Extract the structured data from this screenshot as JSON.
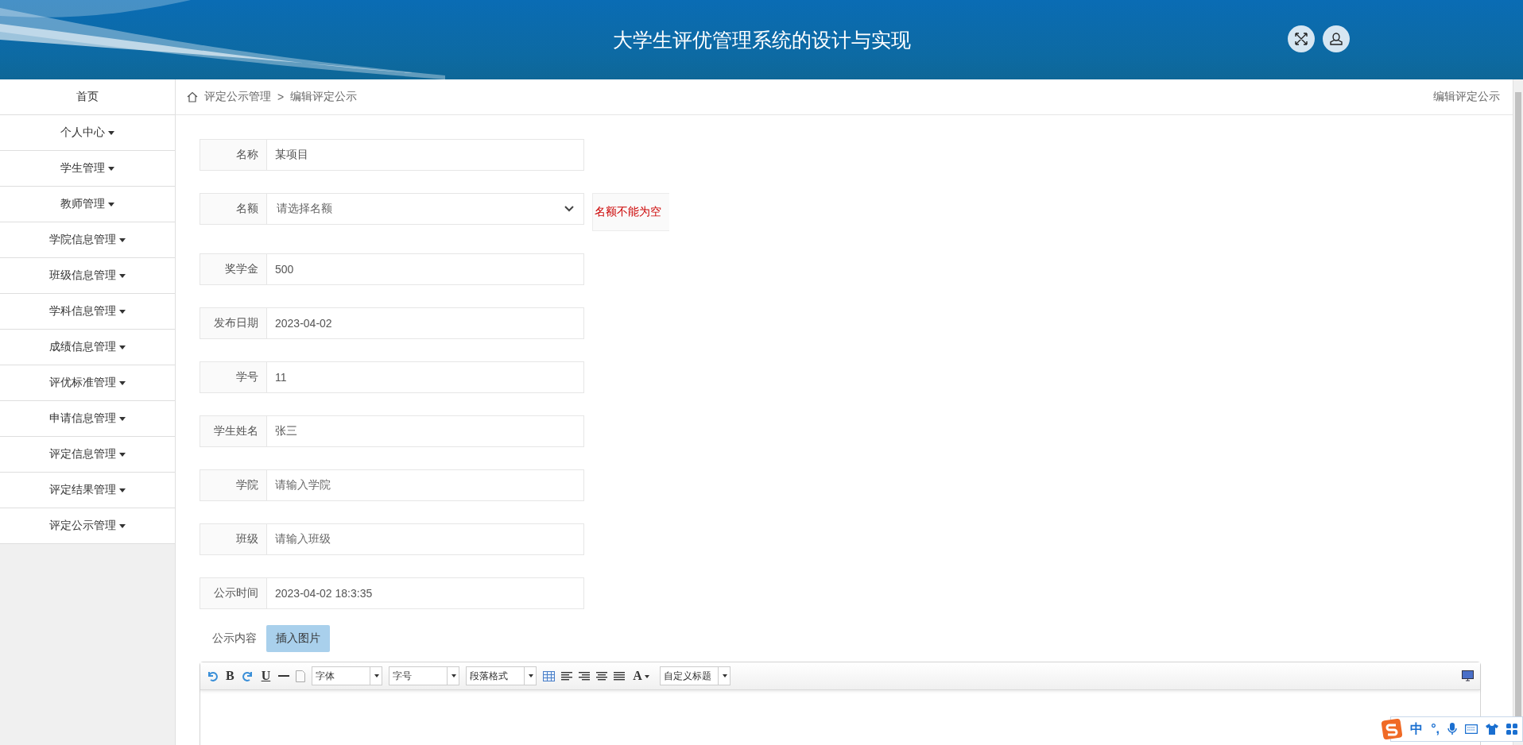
{
  "header": {
    "title": "大学生评优管理系统的设计与实现"
  },
  "sidebar": {
    "items": [
      {
        "label": "首页",
        "has_menu": false
      },
      {
        "label": "个人中心",
        "has_menu": true
      },
      {
        "label": "学生管理",
        "has_menu": true
      },
      {
        "label": "教师管理",
        "has_menu": true
      },
      {
        "label": "学院信息管理",
        "has_menu": true
      },
      {
        "label": "班级信息管理",
        "has_menu": true
      },
      {
        "label": "学科信息管理",
        "has_menu": true
      },
      {
        "label": "成绩信息管理",
        "has_menu": true
      },
      {
        "label": "评优标准管理",
        "has_menu": true
      },
      {
        "label": "申请信息管理",
        "has_menu": true
      },
      {
        "label": "评定信息管理",
        "has_menu": true
      },
      {
        "label": "评定结果管理",
        "has_menu": true
      },
      {
        "label": "评定公示管理",
        "has_menu": true
      }
    ]
  },
  "breadcrumb": {
    "items": [
      "评定公示管理",
      "编辑评定公示"
    ],
    "separator": ">",
    "page_title": "编辑评定公示"
  },
  "form": {
    "fields": [
      {
        "label": "名称",
        "kind": "text",
        "value": "某项目"
      },
      {
        "label": "名额",
        "kind": "select",
        "placeholder": "请选择名额",
        "error": "名额不能为空"
      },
      {
        "label": "奖学金",
        "kind": "text",
        "value": "500"
      },
      {
        "label": "发布日期",
        "kind": "text",
        "value": "2023-04-02"
      },
      {
        "label": "学号",
        "kind": "text",
        "value": "11"
      },
      {
        "label": "学生姓名",
        "kind": "text",
        "value": "张三"
      },
      {
        "label": "学院",
        "kind": "text",
        "placeholder": "请输入学院"
      },
      {
        "label": "班级",
        "kind": "text",
        "placeholder": "请输入班级"
      },
      {
        "label": "公示时间",
        "kind": "text",
        "value": "2023-04-02 18:3:35"
      }
    ],
    "content": {
      "label": "公示内容",
      "upload_button": "插入图片"
    }
  },
  "editor": {
    "toolbar": [
      {
        "kind": "undo"
      },
      {
        "kind": "bold",
        "label": "B"
      },
      {
        "kind": "redo"
      },
      {
        "kind": "underline",
        "label": "U"
      },
      {
        "kind": "rule"
      },
      {
        "kind": "page"
      },
      {
        "kind": "dropdown",
        "label": "字体"
      },
      {
        "kind": "dropdown",
        "label": "字号"
      },
      {
        "kind": "dropdown",
        "label": "段落格式"
      },
      {
        "kind": "table"
      },
      {
        "kind": "align"
      },
      {
        "kind": "align"
      },
      {
        "kind": "align"
      },
      {
        "kind": "align"
      },
      {
        "kind": "color",
        "label": "A"
      },
      {
        "kind": "dropdown",
        "label": "自定义标题"
      }
    ]
  },
  "ime": {
    "mode": "中",
    "punct": "°,"
  }
}
